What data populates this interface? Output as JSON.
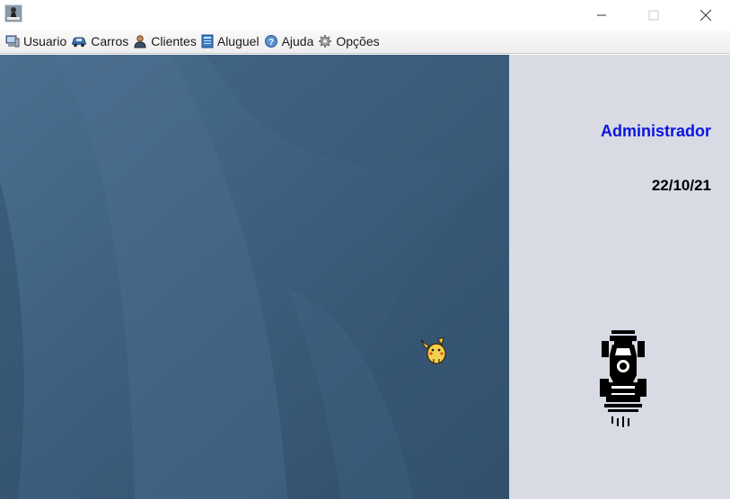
{
  "window": {
    "controls": [
      "minimize-icon",
      "maximize-icon",
      "close-icon"
    ]
  },
  "menu": {
    "items": [
      {
        "label": "Usuario",
        "icon": "computer-icon"
      },
      {
        "label": "Carros",
        "icon": "car-icon"
      },
      {
        "label": "Clientes",
        "icon": "user-icon"
      },
      {
        "label": "Aluguel",
        "icon": "book-icon"
      },
      {
        "label": "Ajuda",
        "icon": "help-icon"
      },
      {
        "label": "Opções",
        "icon": "gear-icon"
      }
    ]
  },
  "side": {
    "user": "Administrador",
    "date": "22/10/21"
  },
  "colors": {
    "user_text": "#0a14e0",
    "desktop_bg": "#3d5f7d",
    "side_bg": "#d8dae4"
  }
}
